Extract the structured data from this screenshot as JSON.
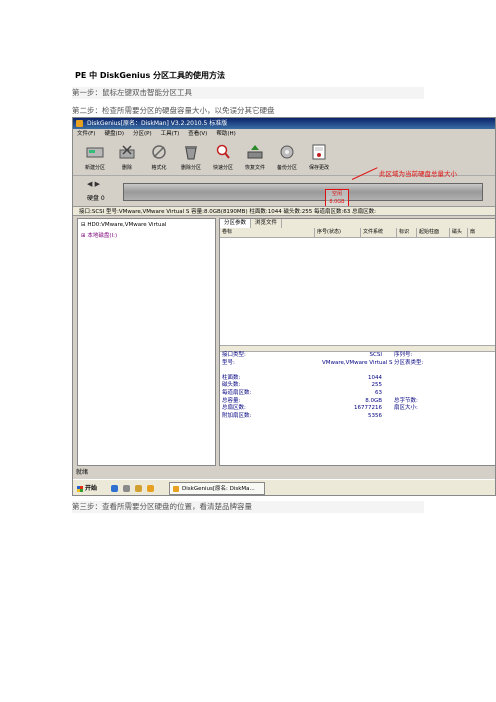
{
  "doc": {
    "title": "PE 中 DiskGenius 分区工具的使用方法",
    "step1": "第一步：鼠标左键双击智能分区工具",
    "step2": "第二步：检查所需要分区的硬盘容量大小，以免误分其它硬盘",
    "step3": "第三步：查看所需要分区硬盘的位置，看清楚品牌容量"
  },
  "app": {
    "title": "DiskGenius[原名：DiskMan] V3.2.2010.5 标准版",
    "menu": [
      "文件(F)",
      "硬盘(D)",
      "分区(P)",
      "工具(T)",
      "查看(V)",
      "帮助(H)"
    ],
    "toolbar": [
      "新建分区",
      "删除",
      "格式化",
      "删除分区",
      "快速分区",
      "恢复文件",
      "备份分区",
      "保存更改"
    ],
    "nav_arrows": "◀ ▶",
    "disk_label": "硬盘 0",
    "free_label": "空闲",
    "free_size": "8.0GB",
    "annotation": "此区域为当前硬盘总量大小",
    "info_line": "接口:SCSI  型号:VMware,VMware Virtual S  容量:8.0GB(8190MB)  柱面数:1044  磁头数:255  每道扇区数:63  总扇区数:",
    "tree": {
      "hd": "HD0:VMware,VMware Virtual",
      "local": "本地磁盘(I:)"
    },
    "tabs": [
      "分区参数",
      "浏览文件"
    ],
    "columns": [
      "卷标",
      "序号(状态)",
      "文件系统",
      "标识",
      "起始柱面",
      "磁头",
      "扇"
    ],
    "details": {
      "rows": [
        {
          "label": "接口类型:",
          "value": "SCSI",
          "label2": "序列号:"
        },
        {
          "label": "型号:",
          "value": "VMware,VMware Virtual S",
          "label2": "分区表类型:"
        },
        {
          "label": "",
          "value": "",
          "label2": ""
        },
        {
          "label": "柱面数:",
          "value": "1044",
          "label2": ""
        },
        {
          "label": "磁头数:",
          "value": "255",
          "label2": ""
        },
        {
          "label": "每道扇区数:",
          "value": "63",
          "label2": ""
        },
        {
          "label": "总容量:",
          "value": "8.0GB",
          "label2": "总字节数:"
        },
        {
          "label": "总扇区数:",
          "value": "16777216",
          "label2": "扇区大小:"
        },
        {
          "label": "附加扇区数:",
          "value": "5356",
          "label2": ""
        }
      ]
    },
    "status": "就绪",
    "start": "开始",
    "task_item": "DiskGenius[原名: DiskMa..."
  }
}
